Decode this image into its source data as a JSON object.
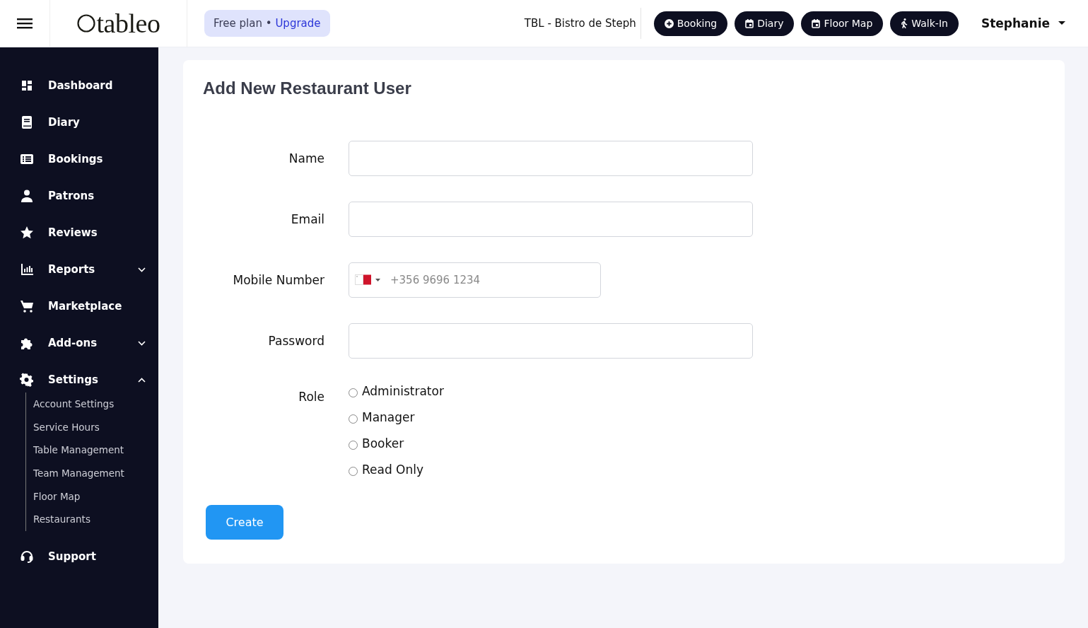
{
  "header": {
    "logo": "tableo",
    "plan": {
      "label": "Free plan •",
      "link": "Upgrade"
    },
    "restaurant": "TBL - Bistro de Steph",
    "actions": [
      "Booking",
      "Diary",
      "Floor Map",
      "Walk-In"
    ],
    "user": "Stephanie"
  },
  "sidebar": {
    "items": [
      {
        "label": "Dashboard"
      },
      {
        "label": "Diary"
      },
      {
        "label": "Bookings"
      },
      {
        "label": "Patrons"
      },
      {
        "label": "Reviews"
      },
      {
        "label": "Reports",
        "expanded": false
      },
      {
        "label": "Marketplace"
      },
      {
        "label": "Add-ons",
        "expanded": false
      },
      {
        "label": "Settings",
        "expanded": true,
        "children": [
          "Account Settings",
          "Service Hours",
          "Table Management",
          "Team Management",
          "Floor Map",
          "Restaurants"
        ]
      },
      {
        "label": "Support"
      }
    ]
  },
  "form": {
    "title": "Add New Restaurant User",
    "fields": [
      {
        "label": "Name",
        "kind": "text"
      },
      {
        "label": "Email",
        "kind": "text"
      },
      {
        "label": "Mobile Number",
        "kind": "phone",
        "placeholder": "+356 9696 1234"
      },
      {
        "label": "Password",
        "kind": "text"
      }
    ],
    "role": {
      "label": "Role",
      "options": [
        {
          "label": "Administrator",
          "selected": false
        },
        {
          "label": "Manager",
          "selected": false
        },
        {
          "label": "Booker",
          "selected": false
        },
        {
          "label": "Read Only",
          "selected": false
        }
      ]
    },
    "submit": "Create"
  }
}
